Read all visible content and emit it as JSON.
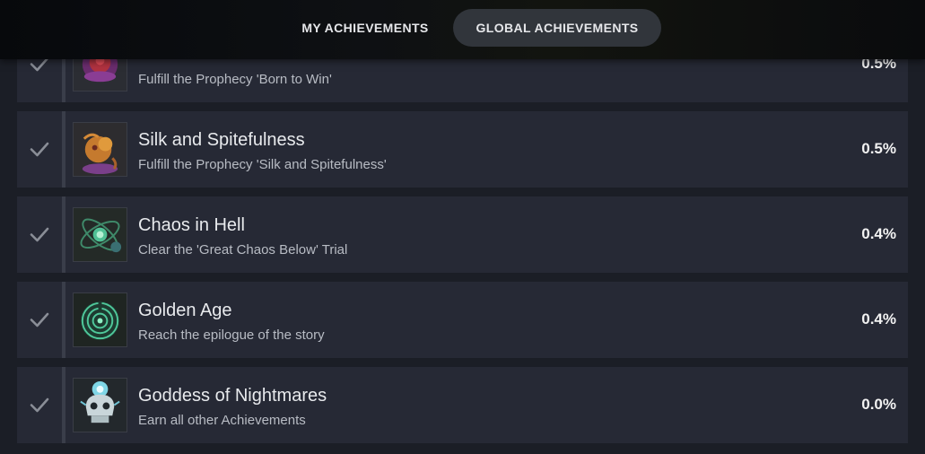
{
  "tabs": {
    "my": "MY ACHIEVEMENTS",
    "global": "GLOBAL ACHIEVEMENTS",
    "active": "global"
  },
  "achievements": [
    {
      "name": "",
      "description": "Fulfill the Prophecy 'Born to Win'",
      "percent": "0.5%",
      "unlocked": true,
      "icon": "born-to-win-icon"
    },
    {
      "name": "Silk and Spitefulness",
      "description": "Fulfill the Prophecy 'Silk and Spitefulness'",
      "percent": "0.5%",
      "unlocked": true,
      "icon": "spider-icon"
    },
    {
      "name": "Chaos in Hell",
      "description": "Clear the 'Great Chaos Below' Trial",
      "percent": "0.4%",
      "unlocked": true,
      "icon": "chaos-orbit-icon"
    },
    {
      "name": "Golden Age",
      "description": "Reach the epilogue of the story",
      "percent": "0.4%",
      "unlocked": true,
      "icon": "labyrinth-icon"
    },
    {
      "name": "Goddess of Nightmares",
      "description": "Earn all other Achievements",
      "percent": "0.0%",
      "unlocked": true,
      "icon": "skull-icon"
    }
  ],
  "colors": {
    "page_bg": "#1b1e26",
    "row_bg": "#262935",
    "check": "#8a8e97",
    "active_tab_bg": "#31353b"
  }
}
